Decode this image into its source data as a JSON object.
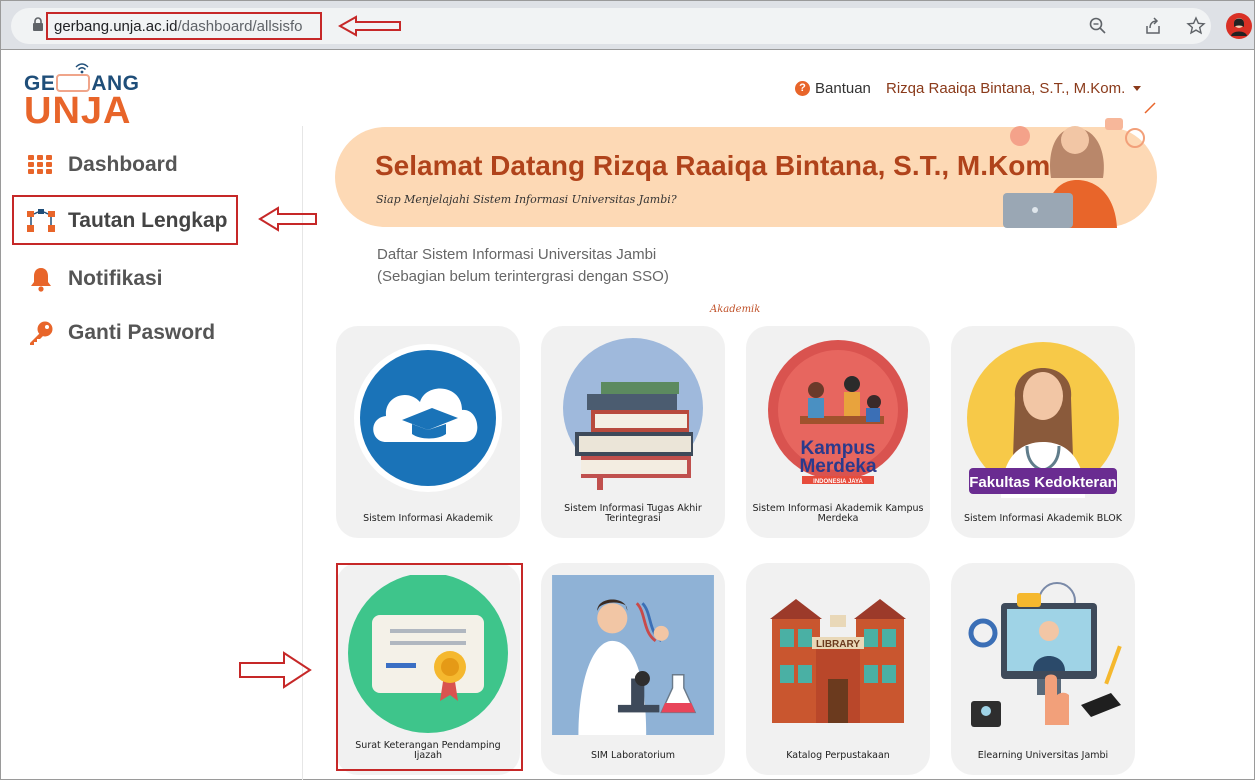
{
  "browser": {
    "url_domain": "gerbang.unja.ac.id",
    "url_path": "/dashboard/allsisfo"
  },
  "logo": {
    "top": "GER ANG",
    "top_left": "GE",
    "top_right": "ANG",
    "bottom": "UNJA"
  },
  "sidebar": {
    "items": [
      {
        "label": "Dashboard",
        "icon": "grid-icon"
      },
      {
        "label": "Tautan Lengkap",
        "icon": "network-icon"
      },
      {
        "label": "Notifikasi",
        "icon": "bell-icon"
      },
      {
        "label": "Ganti Pasword",
        "icon": "key-icon"
      }
    ]
  },
  "header": {
    "help_label": "Bantuan",
    "user_name": "Rizqa Raaiqa Bintana, S.T., M.Kom."
  },
  "banner": {
    "title": "Selamat Datang Rizqa Raaiqa Bintana, S.T., M.Kom",
    "subtitle": "Siap Menjelajahi Sistem Informasi Universitas Jambi?"
  },
  "main": {
    "list_title_1": "Daftar Sistem Informasi Universitas Jambi",
    "list_title_2": "(Sebagian belum terintergrasi dengan SSO)",
    "category": "Akademik",
    "cards": [
      {
        "label": "Sistem Informasi Akademik"
      },
      {
        "label": "Sistem Informasi Tugas Akhir Terintegrasi"
      },
      {
        "label": "Sistem Informasi Akademik Kampus Merdeka",
        "art_text_1": "Kampus",
        "art_text_2": "Merdeka",
        "art_text_3": "INDONESIA JAYA"
      },
      {
        "label": "Sistem Informasi Akademik BLOK",
        "art_text": "Fakultas Kedokteran"
      },
      {
        "label": "Surat Keterangan Pendamping Ijazah"
      },
      {
        "label": "SIM Laboratorium"
      },
      {
        "label": "Katalog Perpustakaan",
        "art_text": "LIBRARY"
      },
      {
        "label": "Elearning Universitas Jambi"
      }
    ]
  },
  "colors": {
    "accent": "#e8652a",
    "annotation": "#c62828",
    "banner_bg": "#fdd9b5",
    "navy": "#1f4e79"
  }
}
